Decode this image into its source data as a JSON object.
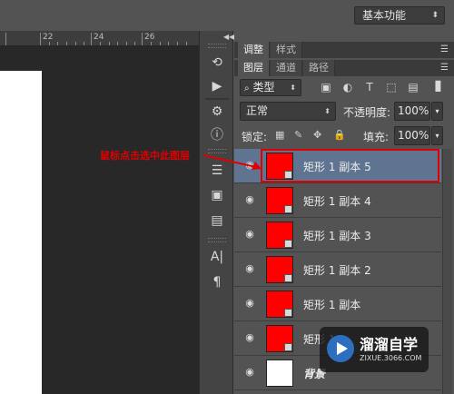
{
  "workspace": {
    "label": "基本功能"
  },
  "ruler": {
    "ticks": [
      "22",
      "24",
      "26"
    ]
  },
  "panels": {
    "top_tabs": [
      "调整",
      "样式"
    ],
    "layer_tabs": [
      "图层",
      "通道",
      "路径"
    ]
  },
  "layers_panel": {
    "filter_kind": "类型",
    "blend_mode": "正常",
    "opacity_label": "不透明度:",
    "opacity_value": "100%",
    "lock_label": "锁定:",
    "fill_label": "填充:",
    "fill_value": "100%",
    "layers": [
      {
        "name": "矩形 1 副本 5",
        "selected": true,
        "thumb_color": "#ff0000"
      },
      {
        "name": "矩形 1 副本 4",
        "selected": false,
        "thumb_color": "#ff0000"
      },
      {
        "name": "矩形 1 副本 3",
        "selected": false,
        "thumb_color": "#ff0000"
      },
      {
        "name": "矩形 1 副本 2",
        "selected": false,
        "thumb_color": "#ff0000"
      },
      {
        "name": "矩形 1 副本",
        "selected": false,
        "thumb_color": "#ff0000"
      },
      {
        "name": "矩形 1",
        "selected": false,
        "thumb_color": "#ff0000"
      },
      {
        "name": "背景",
        "selected": false,
        "thumb_color": "#ffffff"
      }
    ]
  },
  "annotation": {
    "text": "鼠标点击选中此图层",
    "color": "#e00000"
  },
  "watermark": {
    "title": "溜溜自学",
    "url": "ZIXUE.3066.COM"
  }
}
